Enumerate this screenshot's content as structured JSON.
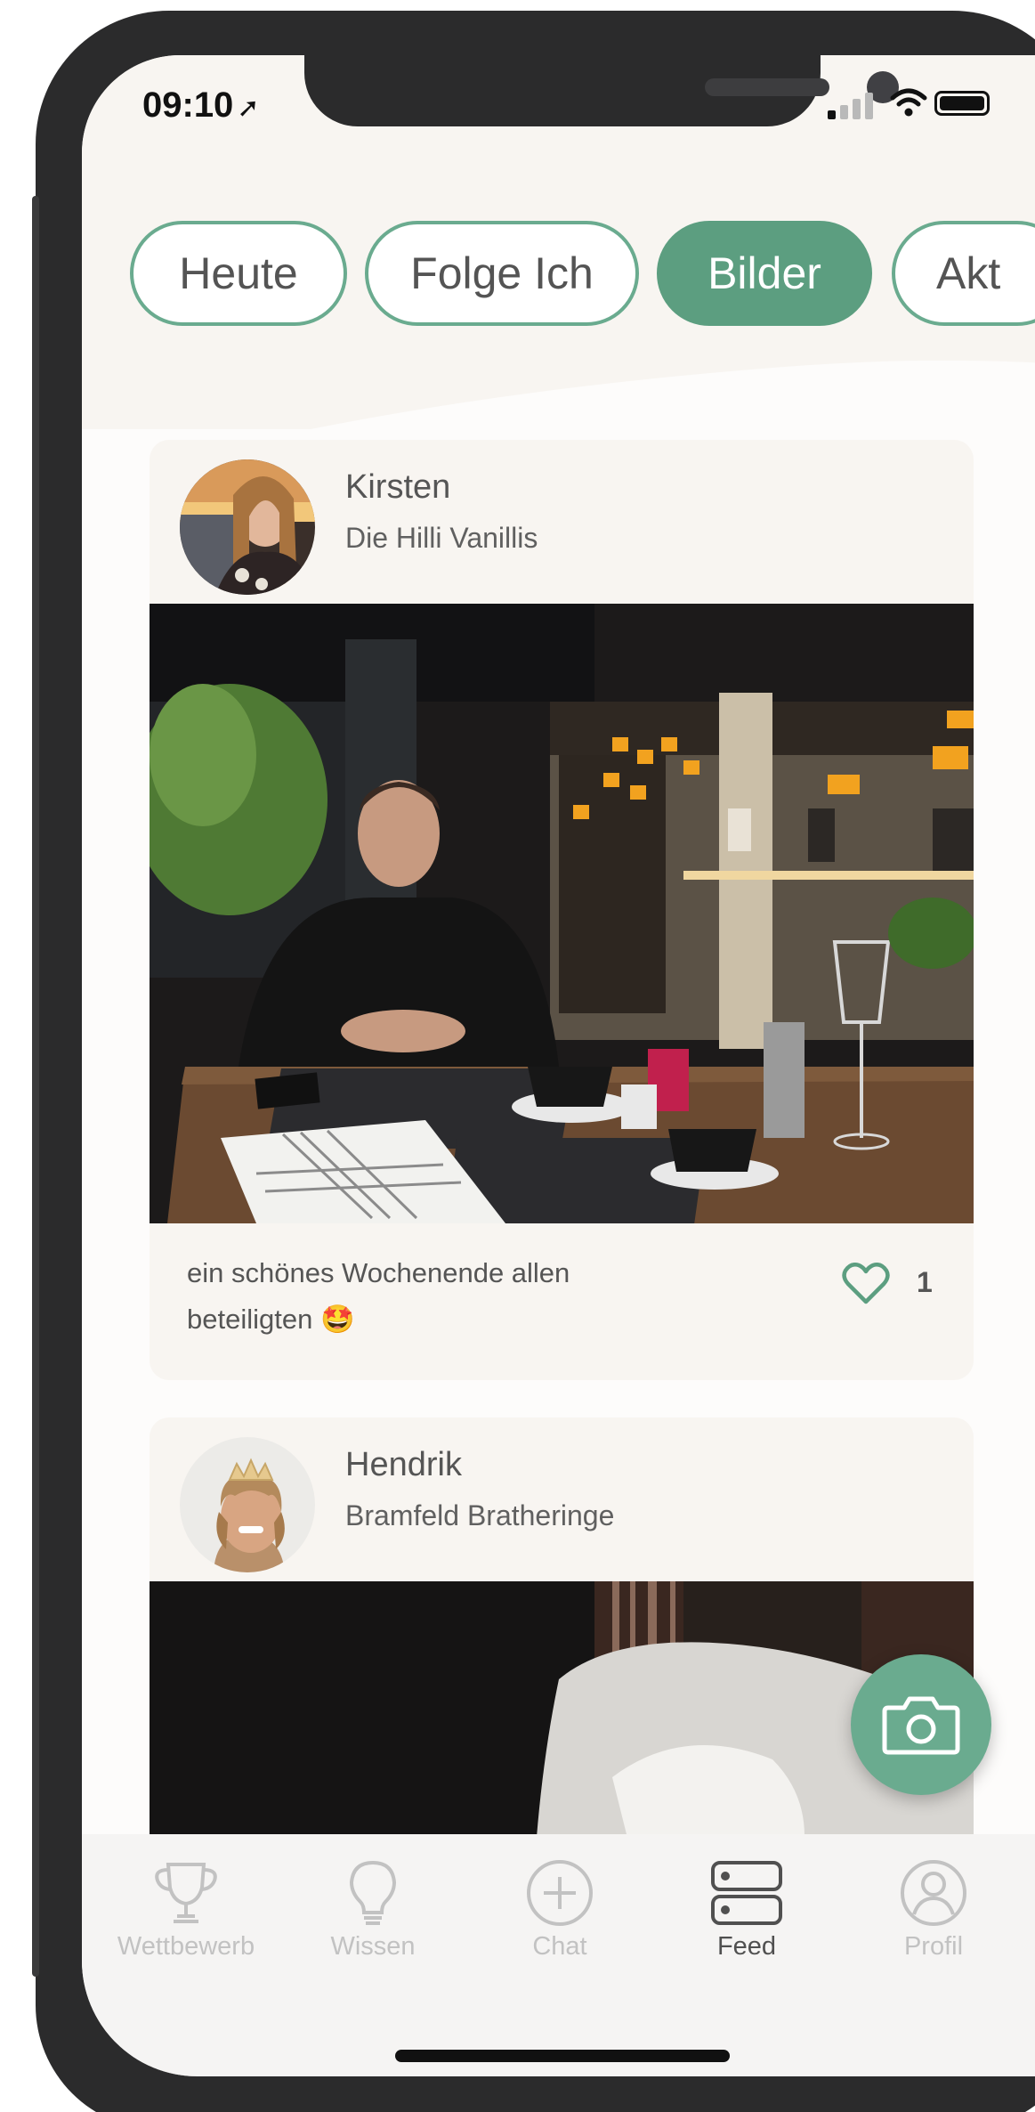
{
  "status_bar": {
    "time": "09:10",
    "location_icon": "location-arrow-icon",
    "signal_icon": "cellular-signal-icon",
    "wifi_icon": "wifi-icon",
    "battery_icon": "battery-icon"
  },
  "filter_tabs": [
    {
      "label": "Heute",
      "active": false
    },
    {
      "label": "Folge Ich",
      "active": false
    },
    {
      "label": "Bilder",
      "active": true
    },
    {
      "label": "Akt",
      "active": false
    }
  ],
  "posts": [
    {
      "author": "Kirsten",
      "team": "Die Hilli Vanillis",
      "caption_line1": "ein schönes Wochenende allen",
      "caption_line2": "beteiligten 🤩",
      "likes": "1"
    },
    {
      "author": "Hendrik",
      "team": "Bramfeld Bratheringe"
    }
  ],
  "fab": {
    "icon": "camera-icon"
  },
  "tab_bar": [
    {
      "label": "Wettbewerb",
      "icon": "trophy-icon",
      "active": false
    },
    {
      "label": "Wissen",
      "icon": "lightbulb-icon",
      "active": false
    },
    {
      "label": "Chat",
      "icon": "plus-circle-icon",
      "active": false
    },
    {
      "label": "Feed",
      "icon": "feed-icon",
      "active": true
    },
    {
      "label": "Profil",
      "icon": "profile-icon",
      "active": false
    }
  ],
  "colors": {
    "accent": "#5c9e80",
    "accent_light": "#6aab8f",
    "card_bg": "#f8f5f1",
    "text": "#555555",
    "tab_inactive": "#c2c2c2"
  }
}
